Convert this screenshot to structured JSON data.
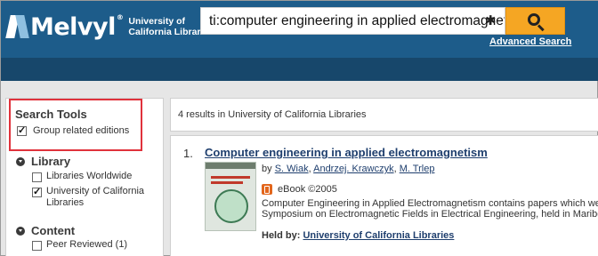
{
  "brand": {
    "name": "Melvyl",
    "registered": "®",
    "subtitle_line1": "University of",
    "subtitle_line2": "California Libraries"
  },
  "search": {
    "query": "ti:computer engineering in applied electromagnetism",
    "clear_glyph": "✱",
    "button_icon": "search-icon",
    "advanced_label": "Advanced Search",
    "accent_color": "#f5a623"
  },
  "sidebar": {
    "search_tools_title": "Search Tools",
    "group_related": {
      "label": "Group related editions",
      "checked": true
    },
    "library": {
      "title": "Library",
      "options": [
        {
          "label": "Libraries Worldwide",
          "checked": false
        },
        {
          "label": "University of California Libraries",
          "checked": true
        }
      ]
    },
    "content": {
      "title": "Content",
      "options": [
        {
          "label": "Peer Reviewed (1)",
          "checked": false
        }
      ]
    }
  },
  "results": {
    "count_text": "4 results in University of California Libraries",
    "items": [
      {
        "number": "1.",
        "title": "Computer engineering in applied electromagnetism",
        "by": "by",
        "authors": [
          "S. Wiak",
          "Andrzej. Krawczyk",
          "M. Trlep"
        ],
        "format": "eBook ©2005",
        "abstract_line1": "Computer Engineering in Applied Electromagnetism contains papers which were",
        "abstract_line2": "Symposium on Electromagnetic Fields in Electrical Engineering, held in Maribor",
        "held_by_label": "Held by:",
        "held_by": "University of California Libraries"
      }
    ]
  },
  "colors": {
    "header_bg": "#1d5c8a",
    "subbar_bg": "#17476b",
    "highlight_border": "#e0323c",
    "link": "#1f3f6e"
  }
}
